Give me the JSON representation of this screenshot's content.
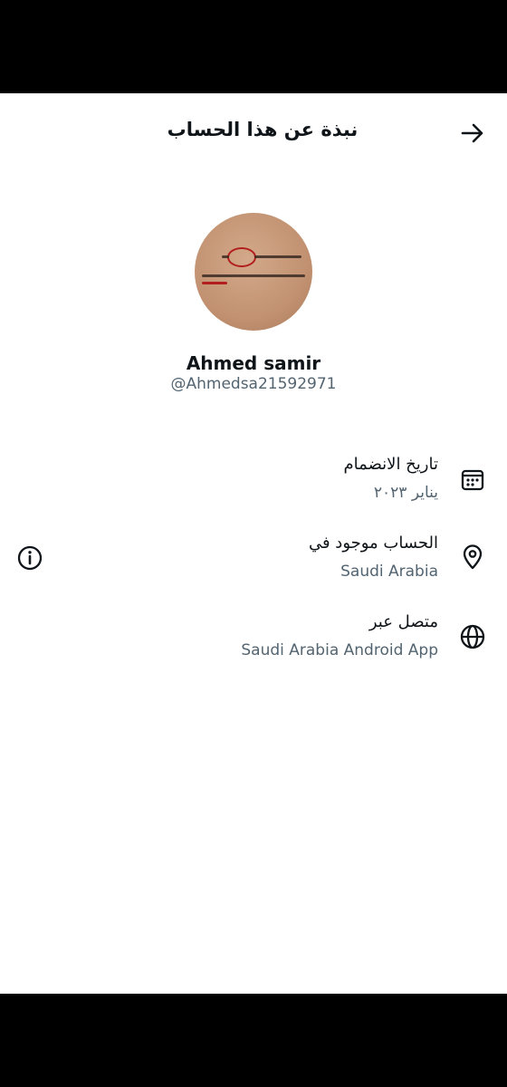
{
  "header": {
    "title": "نبذة عن هذا الحساب",
    "back_icon": "arrow-right-icon"
  },
  "profile": {
    "display_name": "Ahmed samir",
    "handle": "@Ahmedsa21592971"
  },
  "details": [
    {
      "icon": "calendar-icon",
      "title": "تاريخ الانضمام",
      "value": "يناير ٢٠٢٣"
    },
    {
      "icon": "location-pin-icon",
      "title": "الحساب موجود في",
      "value": "Saudi Arabia"
    },
    {
      "icon": "globe-icon",
      "title": "متصل عبر",
      "value": "Saudi Arabia Android App"
    }
  ],
  "colors": {
    "primary_text": "#0f1419",
    "secondary_text": "#536471"
  }
}
